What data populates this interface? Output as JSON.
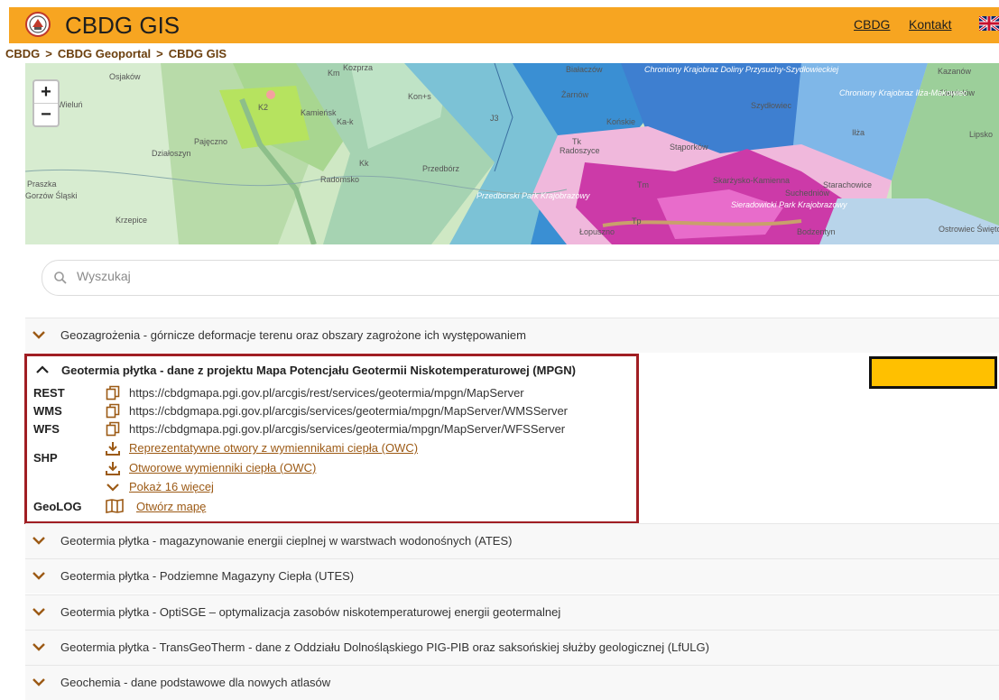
{
  "header": {
    "title": "CBDG GIS",
    "links": [
      "CBDG",
      "Kontakt"
    ],
    "accent_color": "#f7a521"
  },
  "breadcrumb": [
    "CBDG",
    "CBDG Geoportal",
    "CBDG GIS"
  ],
  "map": {
    "zoom_in": "+",
    "zoom_out": "−",
    "labels": [
      "Osjaków",
      "Wieluń",
      "Pajęczno",
      "Działoszyn",
      "Praszka",
      "Gorzów Śląski",
      "Krzepice",
      "Radomsko",
      "Kamieńsk",
      "Przedbórz",
      "Żarnów",
      "Końskie",
      "Stąporków",
      "Szydłowiec",
      "Radoszyce",
      "Skarżysko-Kamienna",
      "Suchedniów",
      "Starachowice",
      "Kazanów",
      "Ciepielów",
      "Iłża",
      "Lipsko",
      "Ostrowiec Świętokrzyski",
      "Bodzentyn",
      "Łopuszno",
      "Białaczów",
      "Chroniony Krajobraz Doliny Przysuchy-Szydłowieckiej",
      "Chroniony Krajobraz Iłża-Makowiec",
      "Przedborski Park Krajobrazowy",
      "Sieradowicki Park Krajobrazowy",
      "Kozprza",
      "Km",
      "Kon+s",
      "K2",
      "Ka-k",
      "Kk",
      "J3",
      "Tk",
      "Tm",
      "Tp"
    ]
  },
  "search": {
    "placeholder": "Wyszukaj"
  },
  "layers": {
    "row1": "Geozagrożenia - górnicze deformacje terenu oraz obszary zagrożone ich występowaniem",
    "expanded": {
      "title": "Geotermia płytka - dane z projektu Mapa Potencjału Geotermii Niskotemperaturowej (MPGN)",
      "services": [
        {
          "label": "REST",
          "url": "https://cbdgmapa.pgi.gov.pl/arcgis/rest/services/geotermia/mpgn/MapServer"
        },
        {
          "label": "WMS",
          "url": "https://cbdgmapa.pgi.gov.pl/arcgis/services/geotermia/mpgn/MapServer/WMSServer"
        },
        {
          "label": "WFS",
          "url": "https://cbdgmapa.pgi.gov.pl/arcgis/services/geotermia/mpgn/MapServer/WFSServer"
        }
      ],
      "shp_label": "SHP",
      "shp_links": [
        "Reprezentatywne otwory z wymiennikami ciepła (OWC)",
        "Otworowe wymienniki ciepła (OWC)"
      ],
      "show_more": "Pokaż 16 więcej",
      "geolog_label": "GeoLOG",
      "geolog_link": "Otwórz mapę"
    },
    "rows_after": [
      "Geotermia płytka - magazynowanie energii cieplnej w warstwach wodonośnych (ATES)",
      "Geotermia płytka - Podziemne Magazyny Ciepła (UTES)",
      "Geotermia płytka - OptiSGE – optymalizacja zasobów niskotemperaturowej energii geotermalnej",
      "Geotermia płytka - TransGeoTherm - dane z Oddziału Dolnośląskiego PIG-PIB oraz saksońskiej służby geologicznej (LfULG)",
      "Geochemia - dane podstawowe dla nowych atlasów"
    ],
    "chevron_color": "#9c5a15",
    "highlight_color": "#a01e23"
  }
}
